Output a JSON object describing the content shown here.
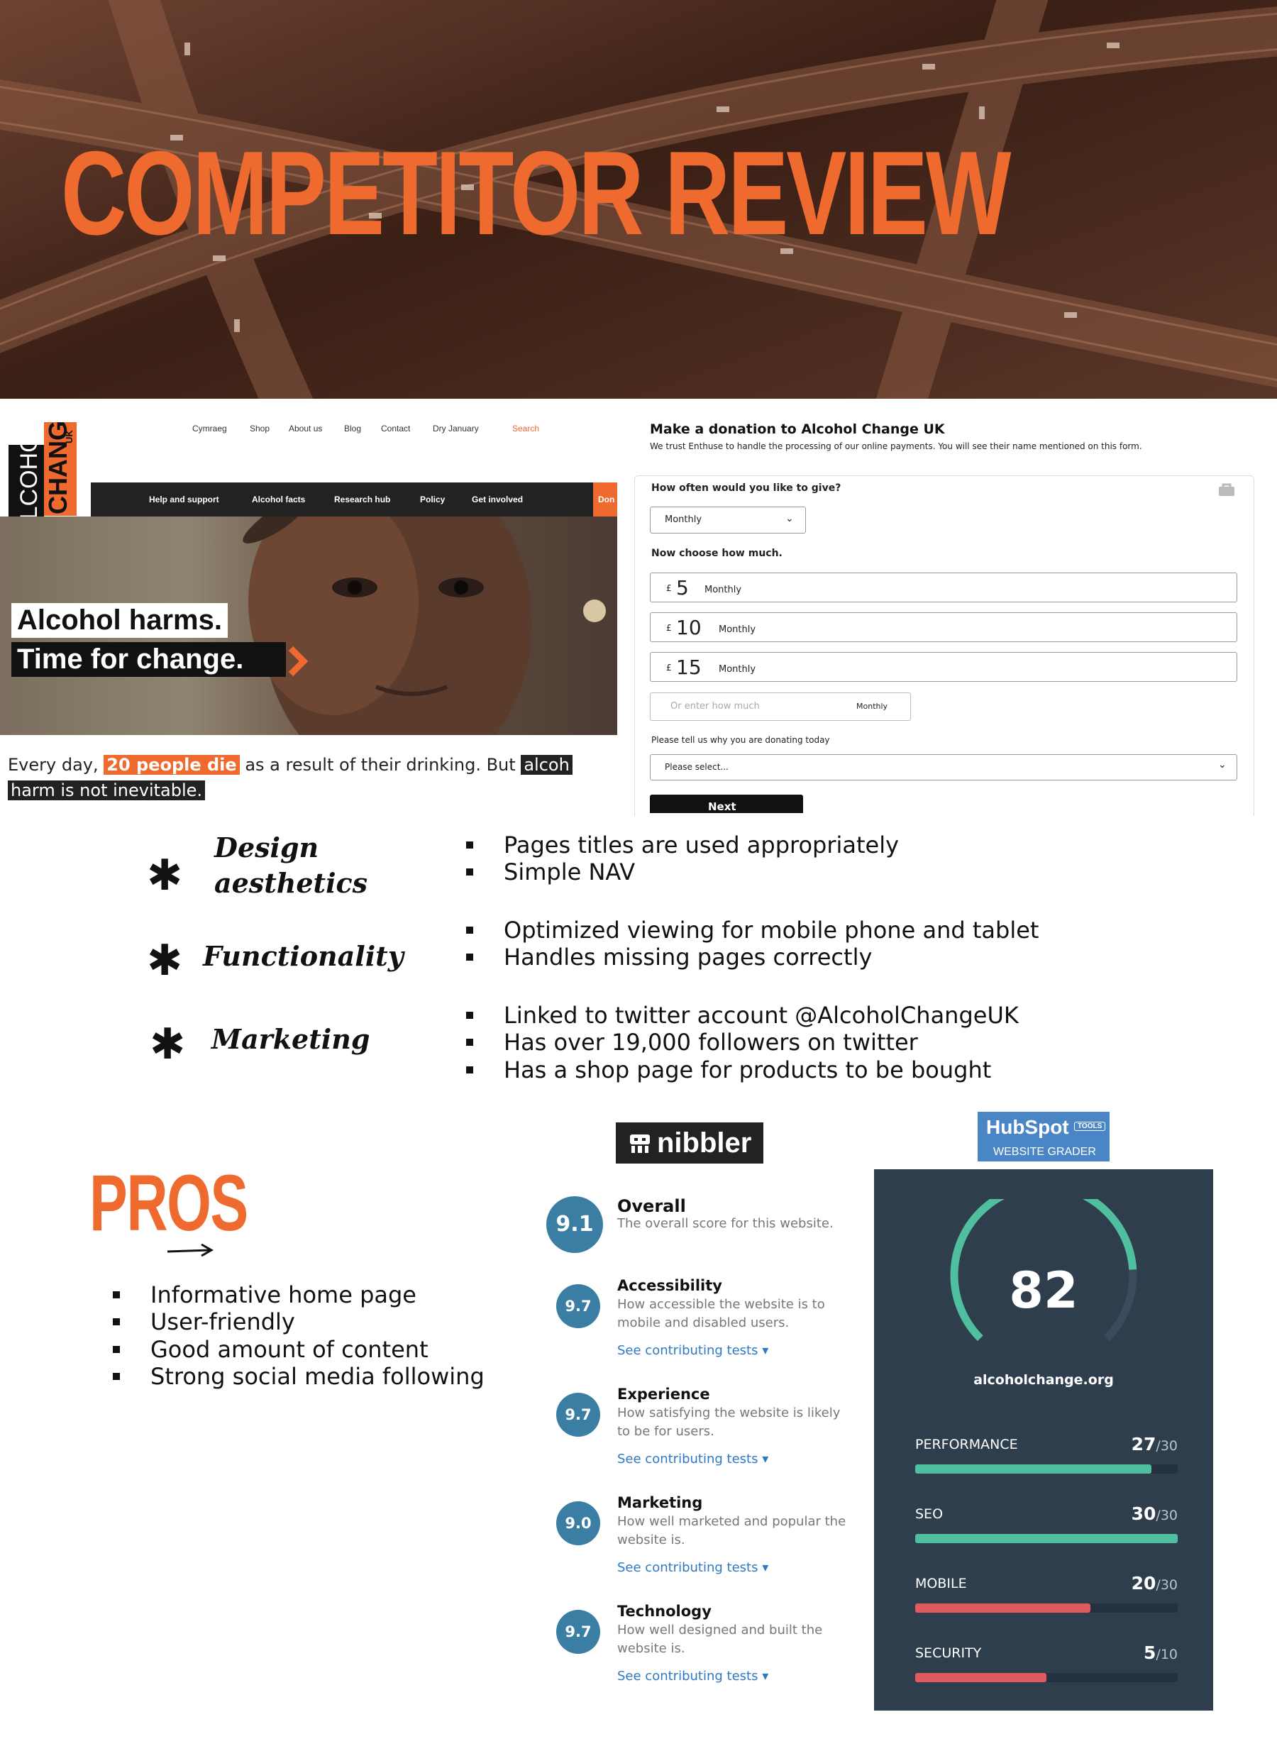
{
  "hero": {
    "title": "COMPETITOR REVIEW"
  },
  "site": {
    "logo_top": "CHANGE",
    "logo_uk": "UK",
    "logo_bottom": "ALCOHOL",
    "top_nav": [
      "Cymraeg",
      "Shop",
      "About us",
      "Blog",
      "Contact",
      "Dry January",
      "Search"
    ],
    "main_nav": [
      "Help and support",
      "Alcohol facts",
      "Research hub",
      "Policy",
      "Get involved",
      "Don"
    ],
    "headline_1": "Alcohol harms.",
    "headline_2": "Time for change.",
    "tagline_part1": "Every day,",
    "tagline_highlight": "20 people die",
    "tagline_part2": "as a result of their drinking. But",
    "tagline_part3": "alcoh",
    "tagline_part4": "harm is not inevitable."
  },
  "donation": {
    "title": "Make a donation to Alcohol Change UK",
    "intro": "We trust Enthuse to handle the processing of our online payments. You will see their name mentioned on this form.",
    "frequency_label": "How often would you like to give?",
    "frequency_value": "Monthly",
    "amount_label": "Now choose how much.",
    "amounts": [
      {
        "currency": "£",
        "value": "5",
        "period": "Monthly"
      },
      {
        "currency": "£",
        "value": "10",
        "period": "Monthly"
      },
      {
        "currency": "£",
        "value": "15",
        "period": "Monthly"
      }
    ],
    "custom_placeholder": "Or enter how much",
    "custom_period": "Monthly",
    "reason_label": "Please tell us why you are donating today",
    "reason_value": "Please select...",
    "next_button": "Next"
  },
  "criteria": [
    {
      "name_line1": "Design",
      "name_line2": "aesthetics",
      "points": [
        "Pages titles are used appropriately",
        "Simple NAV"
      ]
    },
    {
      "name_line1": "Functionality",
      "name_line2": "",
      "points": [
        "Optimized viewing for mobile phone and tablet",
        "Handles missing pages correctly"
      ]
    },
    {
      "name_line1": "Marketing",
      "name_line2": "",
      "points": [
        "Linked to twitter account @AlcoholChangeUK",
        "Has over 19,000 followers on twitter",
        "Has a shop page for products to be bought"
      ]
    }
  ],
  "pros": {
    "title": "PROS",
    "items": [
      "Informative home page",
      "User-friendly",
      "Good amount of content",
      "Strong social media following"
    ]
  },
  "nibbler": {
    "logo": "nibbler",
    "overall": {
      "score": "9.1",
      "title": "Overall",
      "desc": "The overall score for this website."
    },
    "categories": [
      {
        "score": "9.7",
        "title": "Accessibility",
        "desc_1": "How accessible the website is to",
        "desc_2": "mobile and disabled users.",
        "link": "See contributing tests ▾"
      },
      {
        "score": "9.7",
        "title": "Experience",
        "desc_1": "How satisfying the website is likely",
        "desc_2": "to be for users.",
        "link": "See contributing tests ▾"
      },
      {
        "score": "9.0",
        "title": "Marketing",
        "desc_1": "How well marketed and popular the",
        "desc_2": "website is.",
        "link": "See contributing tests ▾"
      },
      {
        "score": "9.7",
        "title": "Technology",
        "desc_1": "How well designed and built the",
        "desc_2": "website is.",
        "link": "See contributing tests ▾"
      }
    ]
  },
  "hubspot": {
    "logo": "HubSpot",
    "tools_badge": "TOOLS",
    "subtitle": "WEBSITE GRADER",
    "total_score": "82",
    "total_max": 100,
    "domain": "alcoholchange.org",
    "metrics": [
      {
        "label": "PERFORMANCE",
        "score": "27",
        "max": "/30",
        "fraction": 0.9,
        "color": "#4fbf9f"
      },
      {
        "label": "SEO",
        "score": "30",
        "max": "/30",
        "fraction": 1.0,
        "color": "#4fbf9f"
      },
      {
        "label": "MOBILE",
        "score": "20",
        "max": "/30",
        "fraction": 0.667,
        "color": "#e05a5f"
      },
      {
        "label": "SECURITY",
        "score": "5",
        "max": "/10",
        "fraction": 0.5,
        "color": "#e05a5f"
      }
    ]
  }
}
